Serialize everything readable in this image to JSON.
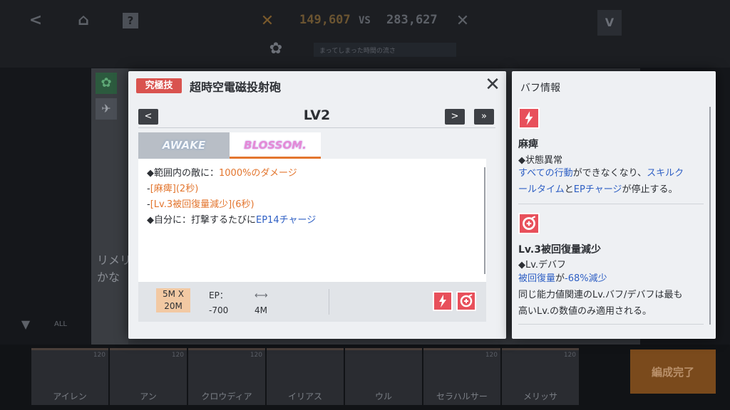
{
  "background": {
    "score_left": "149,607",
    "vs_label": "VS",
    "score_right": "283,627",
    "banner_text": "まってしまった時間の流さ",
    "chars": [
      {
        "name": "アイレン",
        "lv": "120"
      },
      {
        "name": "アン",
        "lv": "120"
      },
      {
        "name": "クロウディア",
        "lv": "120"
      },
      {
        "name": "イリアス",
        "lv": ""
      },
      {
        "name": "ウル",
        "lv": ""
      },
      {
        "name": "セラハルサー",
        "lv": "120"
      },
      {
        "name": "メリッサ",
        "lv": "120"
      }
    ],
    "side_text_1": "リメリ",
    "side_text_2": "かな",
    "filter_label": "ALL",
    "confirm_label": "編成完了"
  },
  "dialog": {
    "tag": "究極技",
    "skill_name": "超時空電磁投射砲",
    "level": "LV2",
    "nav_prev": "<",
    "nav_next": ">",
    "nav_last": "»",
    "close": "✕",
    "tabs": {
      "awake": "AWAKE",
      "blossom": "BLOSSOM."
    },
    "desc": {
      "l1_prefix": "◆範囲内の敵に：",
      "l1_value": "1000%のダメージ",
      "l2_dash": "-",
      "l2_value": "[麻痺](2秒)",
      "l3_dash": "-",
      "l3_value": "[Lv.3被回復量減少](6秒)",
      "l4_prefix": "◆自分に：打撃するたびに",
      "l4_value": "EP14チャージ"
    },
    "stats": {
      "range_line1": "5M X",
      "range_line2": "20M",
      "ep_label": "EP：",
      "ep_value": "-700",
      "dist_icon": "⟷",
      "dist_value": "4M"
    }
  },
  "buffs": {
    "title": "バフ情報",
    "items": [
      {
        "name": "麻痺",
        "type": "◆状態異常",
        "d1": "すべての行動",
        "d2": "ができなくなり、",
        "d3": "スキルク",
        "d4": "ールタイム",
        "d5": "と",
        "d6": "EPチャージ",
        "d7": "が停止する。"
      },
      {
        "name": "Lv.3被回復量減少",
        "type": "◆Lv.デバフ",
        "d1": "被回復量",
        "d2": "が",
        "d3": "-68%減少",
        "d4": "同じ能力値関連のLv.バフ/デバフは最も",
        "d5": "高いLv.の数値のみ適用される。"
      }
    ]
  },
  "colors": {
    "accent_orange": "#e3762f",
    "accent_blue": "#2e5fc4",
    "tag_red": "#d9534f",
    "icon_red": "#e8505b"
  }
}
